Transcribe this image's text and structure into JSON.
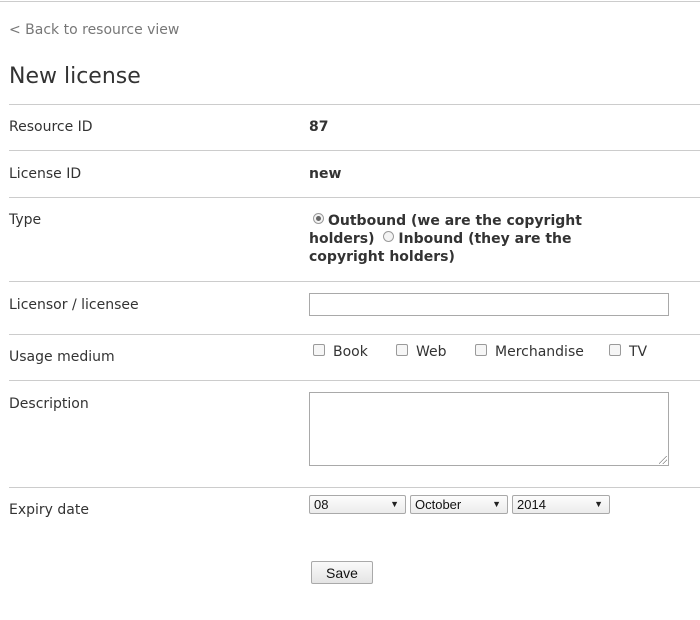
{
  "nav": {
    "back_label": "< Back to resource view"
  },
  "page": {
    "title": "New license"
  },
  "fields": {
    "resource_id": {
      "label": "Resource ID",
      "value": "87"
    },
    "license_id": {
      "label": "License ID",
      "value": "new"
    },
    "type": {
      "label": "Type",
      "options": [
        {
          "label": "Outbound (we are the copyright holders)",
          "selected": true
        },
        {
          "label": "Inbound (they are the copyright holders)",
          "selected": false
        }
      ]
    },
    "licensor": {
      "label": "Licensor / licensee",
      "value": ""
    },
    "usage_medium": {
      "label": "Usage medium",
      "options": [
        {
          "label": "Book",
          "checked": false
        },
        {
          "label": "Web",
          "checked": false
        },
        {
          "label": "Merchandise",
          "checked": false
        },
        {
          "label": "TV",
          "checked": false
        }
      ]
    },
    "description": {
      "label": "Description",
      "value": ""
    },
    "expiry_date": {
      "label": "Expiry date",
      "day": "08",
      "month": "October",
      "year": "2014"
    }
  },
  "actions": {
    "save_label": "Save"
  },
  "icons": {
    "select_arrow": "triangle-down-icon"
  }
}
